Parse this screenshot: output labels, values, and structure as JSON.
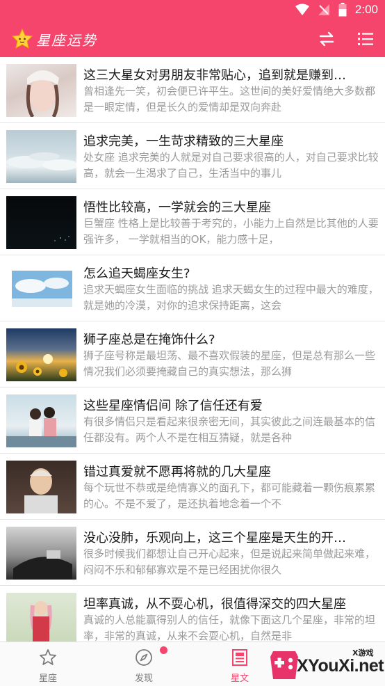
{
  "status_bar": {
    "time": "2:00",
    "icons": [
      "wifi-icon",
      "no-signal-icon",
      "battery-icon"
    ]
  },
  "app_bar": {
    "title": "星座运势",
    "logo_icon": "star-icon",
    "actions": [
      "swap-icon",
      "list-icon"
    ]
  },
  "articles": [
    {
      "title": "这三大星女对男朋友非常贴心，追到就是赚到…",
      "desc": "曾相逢先一笑，初会便已许平生。这世间的美好爱情绝大多数都是一眼定情，但是长久的爱情却是双向奔赴"
    },
    {
      "title": "追求完美，一生苛求精致的三大星座",
      "desc": "处女座 追求完美的人就是对自己要求很高的人，对自己要求比较高，就会一生渴求了自己，生活当中的事儿"
    },
    {
      "title": "悟性比较高，一学就会的三大星座",
      "desc": "巨蟹座 性格上是比较善于考究的，小能力上自然是比其他的人要强许多， 一学就相当的OK，能力感十足，"
    },
    {
      "title": "怎么追天蝎座女生?",
      "desc": "追求天蝎座女生面临的挑战 追求天蝎女生的过程中最大的难度，就是她的冷漠，对你的追求保持距离，这会"
    },
    {
      "title": "狮子座总是在掩饰什么?",
      "desc": "狮子座号称是最坦荡、最不喜欢假装的星座，但是总有那么一些情况我们必须要掩藏自己的真实想法，那么狮"
    },
    {
      "title": "这些星座情侣间 除了信任还有爱",
      "desc": "有很多情侣只是看起来很亲密无间，其实彼此之间连最基本的信任都没有。两个人不是在相互猜疑，就是各种"
    },
    {
      "title": "错过真爱就不愿再将就的几大星座",
      "desc": "每个玩世不恭或是绝情寡义的面孔下，都可能藏着一颗伤痕累累的心。不是不爱了，是还执着地念着一个不"
    },
    {
      "title": "没心没肺，乐观向上，这三个星座是天生的开…",
      "desc": "很多时候我们都想让自己开心起来，但是说起来简单做起来难，闷闷不乐和郁郁寡欢是不是已经困扰你很久"
    },
    {
      "title": "坦率真诚，从不耍心机，很值得深交的四大星座",
      "desc": "真诚的人总能赢得别人的信任，就像下面这几个星座，非常的坦率，非常的真诚，从来不会耍心机，自然是非"
    }
  ],
  "bottom_nav": [
    {
      "label": "星座",
      "icon": "star-outline-icon",
      "active": false
    },
    {
      "label": "发现",
      "icon": "compass-icon",
      "active": false,
      "badge_dot": true
    },
    {
      "label": "星文",
      "icon": "article-icon",
      "active": true
    },
    {
      "label": "",
      "icon": "",
      "active": false
    }
  ],
  "watermark": {
    "text": "XYouXi.net",
    "cn": "X游戏"
  },
  "colors": {
    "primary": "#f5456d",
    "title_text": "#1a1a1a",
    "desc_text": "#9a9a9a"
  }
}
